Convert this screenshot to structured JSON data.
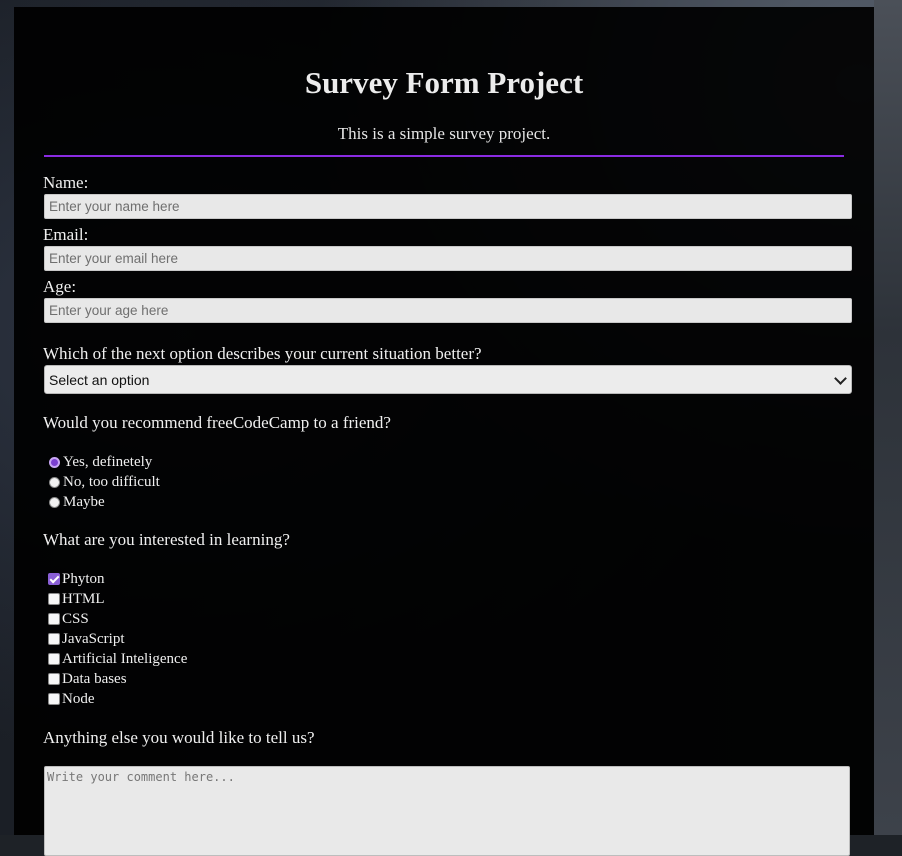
{
  "page": {
    "title": "Survey Form Project",
    "description": "This is a simple survey project."
  },
  "colors": {
    "accent": "#8a2be2",
    "panel_bg": "#000000",
    "input_bg": "#e8e8e8"
  },
  "fields": {
    "name": {
      "label": "Name:",
      "placeholder": "Enter your name here"
    },
    "email": {
      "label": "Email:",
      "placeholder": "Enter your email here"
    },
    "age": {
      "label": "Age:",
      "placeholder": "Enter your age here"
    }
  },
  "situation": {
    "question": "Which of the next option describes your current situation better?",
    "selected": "Select an option"
  },
  "recommend": {
    "question": "Would you recommend freeCodeCamp to a friend?",
    "options": [
      {
        "label": "Yes, definetely",
        "checked": true
      },
      {
        "label": "No, too difficult",
        "checked": false
      },
      {
        "label": "Maybe",
        "checked": false
      }
    ]
  },
  "interests": {
    "question": "What are you interested in learning?",
    "options": [
      {
        "label": "Phyton",
        "checked": true
      },
      {
        "label": "HTML",
        "checked": false
      },
      {
        "label": "CSS",
        "checked": false
      },
      {
        "label": "JavaScript",
        "checked": false
      },
      {
        "label": "Artificial Inteligence",
        "checked": false
      },
      {
        "label": "Data bases",
        "checked": false
      },
      {
        "label": "Node",
        "checked": false
      }
    ]
  },
  "comments": {
    "question": "Anything else you would like to tell us?",
    "placeholder": "Write your comment here..."
  }
}
